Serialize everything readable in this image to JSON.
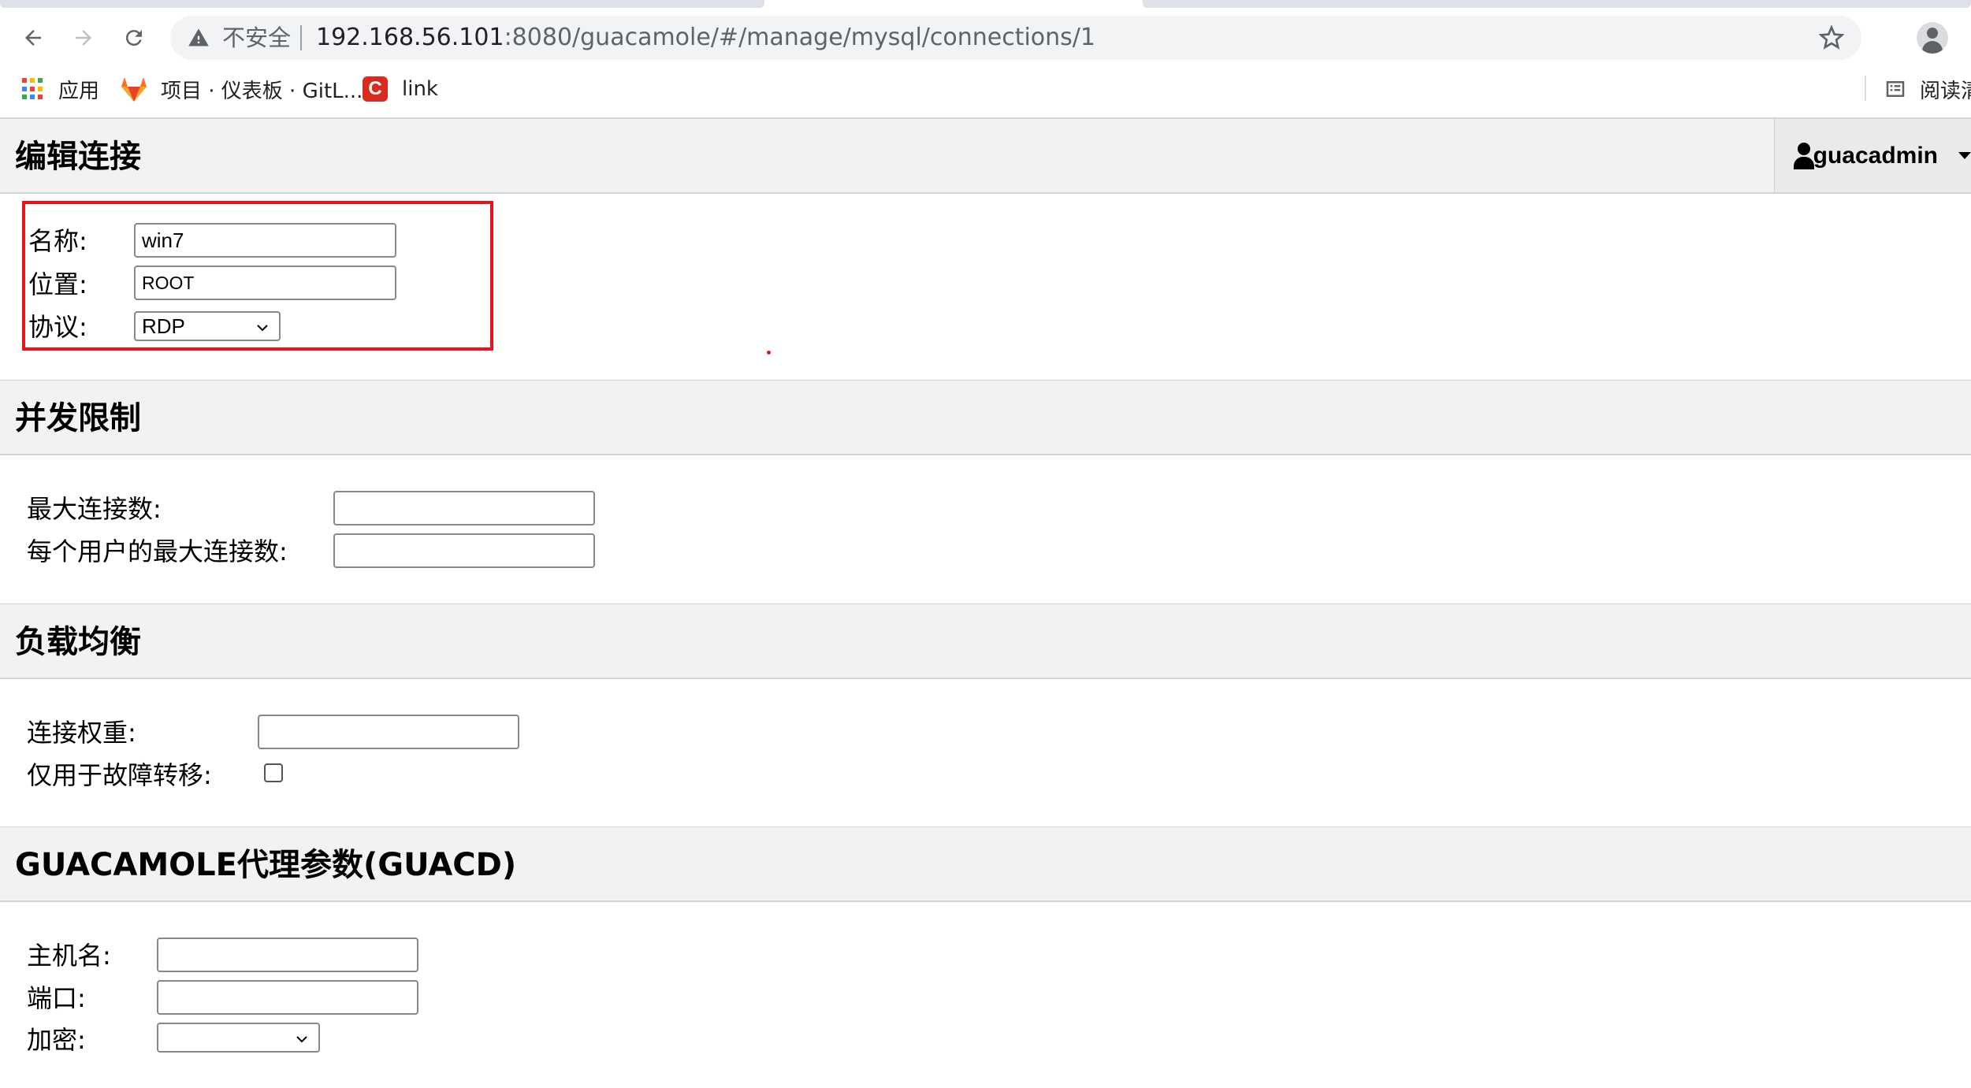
{
  "browser": {
    "security_label": "不安全",
    "url_host": "192.168.56.101",
    "url_path": ":8080/guacamole/#/manage/mysql/connections/1",
    "bookmarks": [
      {
        "label": "应用",
        "icon": "apps-grid-icon"
      },
      {
        "label": "项目 · 仪表板 · GitL...",
        "icon": "gitlab-icon"
      },
      {
        "label": "link",
        "icon": "c-logo-icon"
      }
    ],
    "reading_list_label": "阅读清"
  },
  "user_menu": {
    "username": "guacadmin"
  },
  "edit_connection": {
    "title": "编辑连接",
    "name_label": "名称:",
    "name_value": "win7",
    "location_label": "位置:",
    "location_value": "ROOT",
    "protocol_label": "协议:",
    "protocol_value": "RDP"
  },
  "concurrency": {
    "title": "并发限制",
    "max_connections_label": "最大连接数:",
    "max_connections_value": "",
    "max_per_user_label": "每个用户的最大连接数:",
    "max_per_user_value": ""
  },
  "load_balancing": {
    "title": "负载均衡",
    "weight_label": "连接权重:",
    "weight_value": "",
    "failover_label": "仅用于故障转移:",
    "failover_checked": false
  },
  "guacd": {
    "title": "GUACAMOLE代理参数(GUACD)",
    "hostname_label": "主机名:",
    "hostname_value": "",
    "port_label": "端口:",
    "port_value": "",
    "encryption_label": "加密:",
    "encryption_value": ""
  },
  "colors": {
    "highlight": "#e8141c",
    "section_header_bg": "#f2f2f2"
  }
}
